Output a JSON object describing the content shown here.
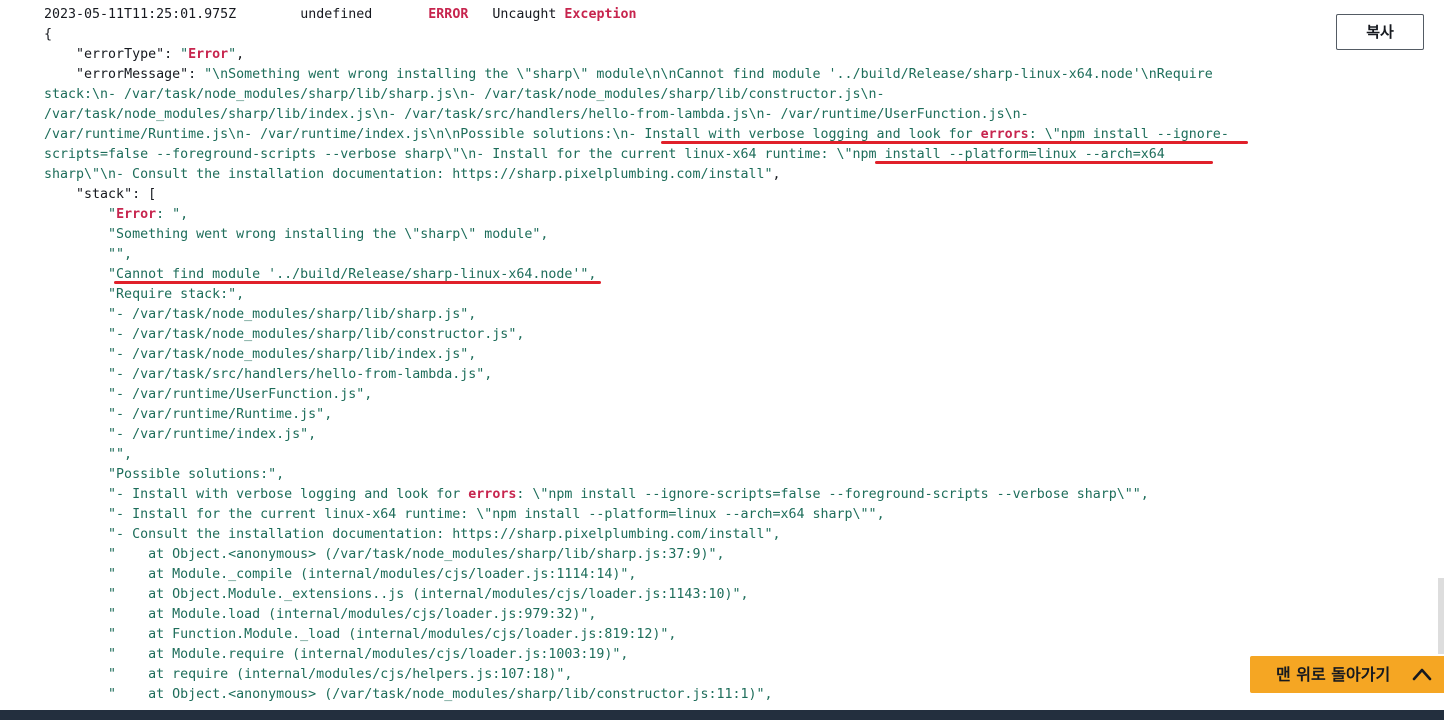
{
  "log_header": {
    "timestamp": "2023-05-11T11:25:01.975Z",
    "request_id": "undefined",
    "level": "ERROR",
    "message_prefix": "Uncaught",
    "message_type": "Exception"
  },
  "keys": {
    "error_type": "\"errorType\"",
    "error_message": "\"errorMessage\"",
    "stack": "\"stack\""
  },
  "error_type_value": "Error",
  "error_message_value": {
    "line1": "\"\\nSomething went wrong installing the \\\"sharp\\\" module\\n\\nCannot find module '../build/Release/sharp-linux-x64.node'\\nRequire",
    "line2": "stack:\\n- /var/task/node_modules/sharp/lib/sharp.js\\n- /var/task/node_modules/sharp/lib/constructor.js\\n-",
    "line3": "/var/task/node_modules/sharp/lib/index.js\\n- /var/task/src/handlers/hello-from-lambda.js\\n- /var/runtime/UserFunction.js\\n-",
    "line4_a": "/var/runtime/Runtime.js\\n- /var/runtime/index.js\\n\\nPossible solutions:\\n- Install with verbose logging and look for ",
    "line4_err": "errors",
    "line4_b": ": \\\"npm install --ignore-",
    "line5": "scripts=false --foreground-scripts --verbose sharp\\\"\\n- Install for the current linux-x64 runtime: \\\"npm install --platform=linux --arch=x64",
    "line6": "sharp\\\"\\n- Consult the installation documentation: https://sharp.pixelplumbing.com/install\""
  },
  "stack_lines": [
    "\"Something went wrong installing the \\\"sharp\\\" module\",",
    "\"\",",
    "\"Cannot find module '../build/Release/sharp-linux-x64.node'\",",
    "\"Require stack:\",",
    "\"- /var/task/node_modules/sharp/lib/sharp.js\",",
    "\"- /var/task/node_modules/sharp/lib/constructor.js\",",
    "\"- /var/task/node_modules/sharp/lib/index.js\",",
    "\"- /var/task/src/handlers/hello-from-lambda.js\",",
    "\"- /var/runtime/UserFunction.js\",",
    "\"- /var/runtime/Runtime.js\",",
    "\"- /var/runtime/index.js\",",
    "\"\",",
    "\"Possible solutions:\","
  ],
  "stack_first": {
    "open": "\"",
    "err": "Error",
    "close": ": \","
  },
  "solution_line": {
    "a": "\"- Install with verbose logging and look for ",
    "err": "errors",
    "b": ": \\\"npm install --ignore-scripts=false --foreground-scripts --verbose sharp\\\"\","
  },
  "stack_tail": [
    "\"- Install for the current linux-x64 runtime: \\\"npm install --platform=linux --arch=x64 sharp\\\"\",",
    "\"- Consult the installation documentation: https://sharp.pixelplumbing.com/install\",",
    "\"    at Object.<anonymous> (/var/task/node_modules/sharp/lib/sharp.js:37:9)\",",
    "\"    at Module._compile (internal/modules/cjs/loader.js:1114:14)\",",
    "\"    at Object.Module._extensions..js (internal/modules/cjs/loader.js:1143:10)\",",
    "\"    at Module.load (internal/modules/cjs/loader.js:979:32)\",",
    "\"    at Function.Module._load (internal/modules/cjs/loader.js:819:12)\",",
    "\"    at Module.require (internal/modules/cjs/loader.js:1003:19)\",",
    "\"    at require (internal/modules/cjs/helpers.js:107:18)\",",
    "\"    at Object.<anonymous> (/var/task/node_modules/sharp/lib/constructor.js:11:1)\","
  ],
  "punct": {
    "open_brace": "{",
    "colon_space": ": ",
    "comma": ",",
    "stack_open": ": ["
  },
  "buttons": {
    "copy": "복사",
    "back_to_top": "맨 위로 돌아가기"
  },
  "colors": {
    "string": "#1d6d5a",
    "error_highlight": "#c7254e",
    "underline_annotation": "#e0202a",
    "top_button": "#f5a623",
    "bottom_bar": "#232f3e"
  }
}
